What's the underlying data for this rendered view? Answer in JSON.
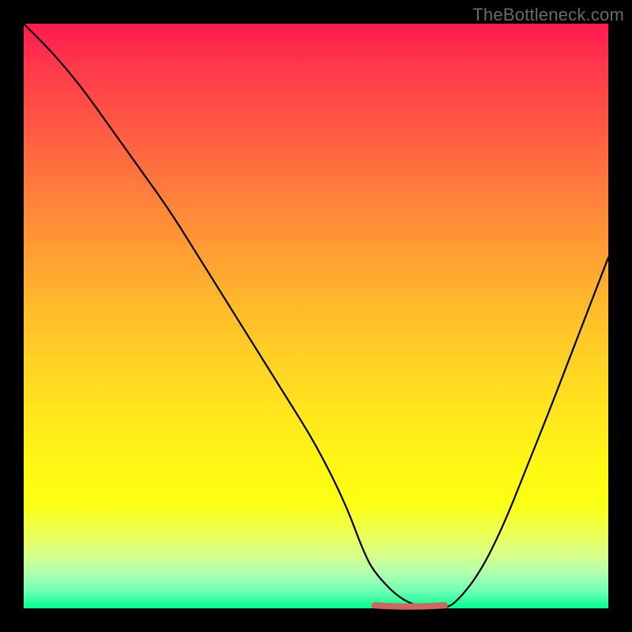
{
  "watermark": "TheBottleneck.com",
  "colors": {
    "frame": "#000000",
    "gradient_top": "#ff1a50",
    "gradient_bottom": "#00ff90",
    "curve": "#000000",
    "flat_segment": "#cc6860"
  },
  "chart_data": {
    "type": "line",
    "title": "",
    "xlabel": "",
    "ylabel": "",
    "xlim": [
      0,
      100
    ],
    "ylim": [
      0,
      100
    ],
    "series": [
      {
        "name": "bottleneck-curve",
        "x": [
          0,
          5,
          10,
          15,
          20,
          25,
          30,
          35,
          40,
          45,
          50,
          55,
          58,
          60,
          65,
          70,
          72,
          74,
          78,
          82,
          86,
          90,
          95,
          100
        ],
        "values": [
          100,
          95,
          89,
          82,
          75,
          68,
          60,
          52,
          44,
          36,
          28,
          18,
          10,
          6,
          1,
          0,
          0,
          1,
          6,
          14,
          24,
          34,
          47,
          60
        ]
      }
    ],
    "annotations": [
      {
        "name": "optimal-flat-segment",
        "x_start": 60,
        "x_end": 72,
        "y": 0.5,
        "color": "#cc6860"
      }
    ]
  }
}
